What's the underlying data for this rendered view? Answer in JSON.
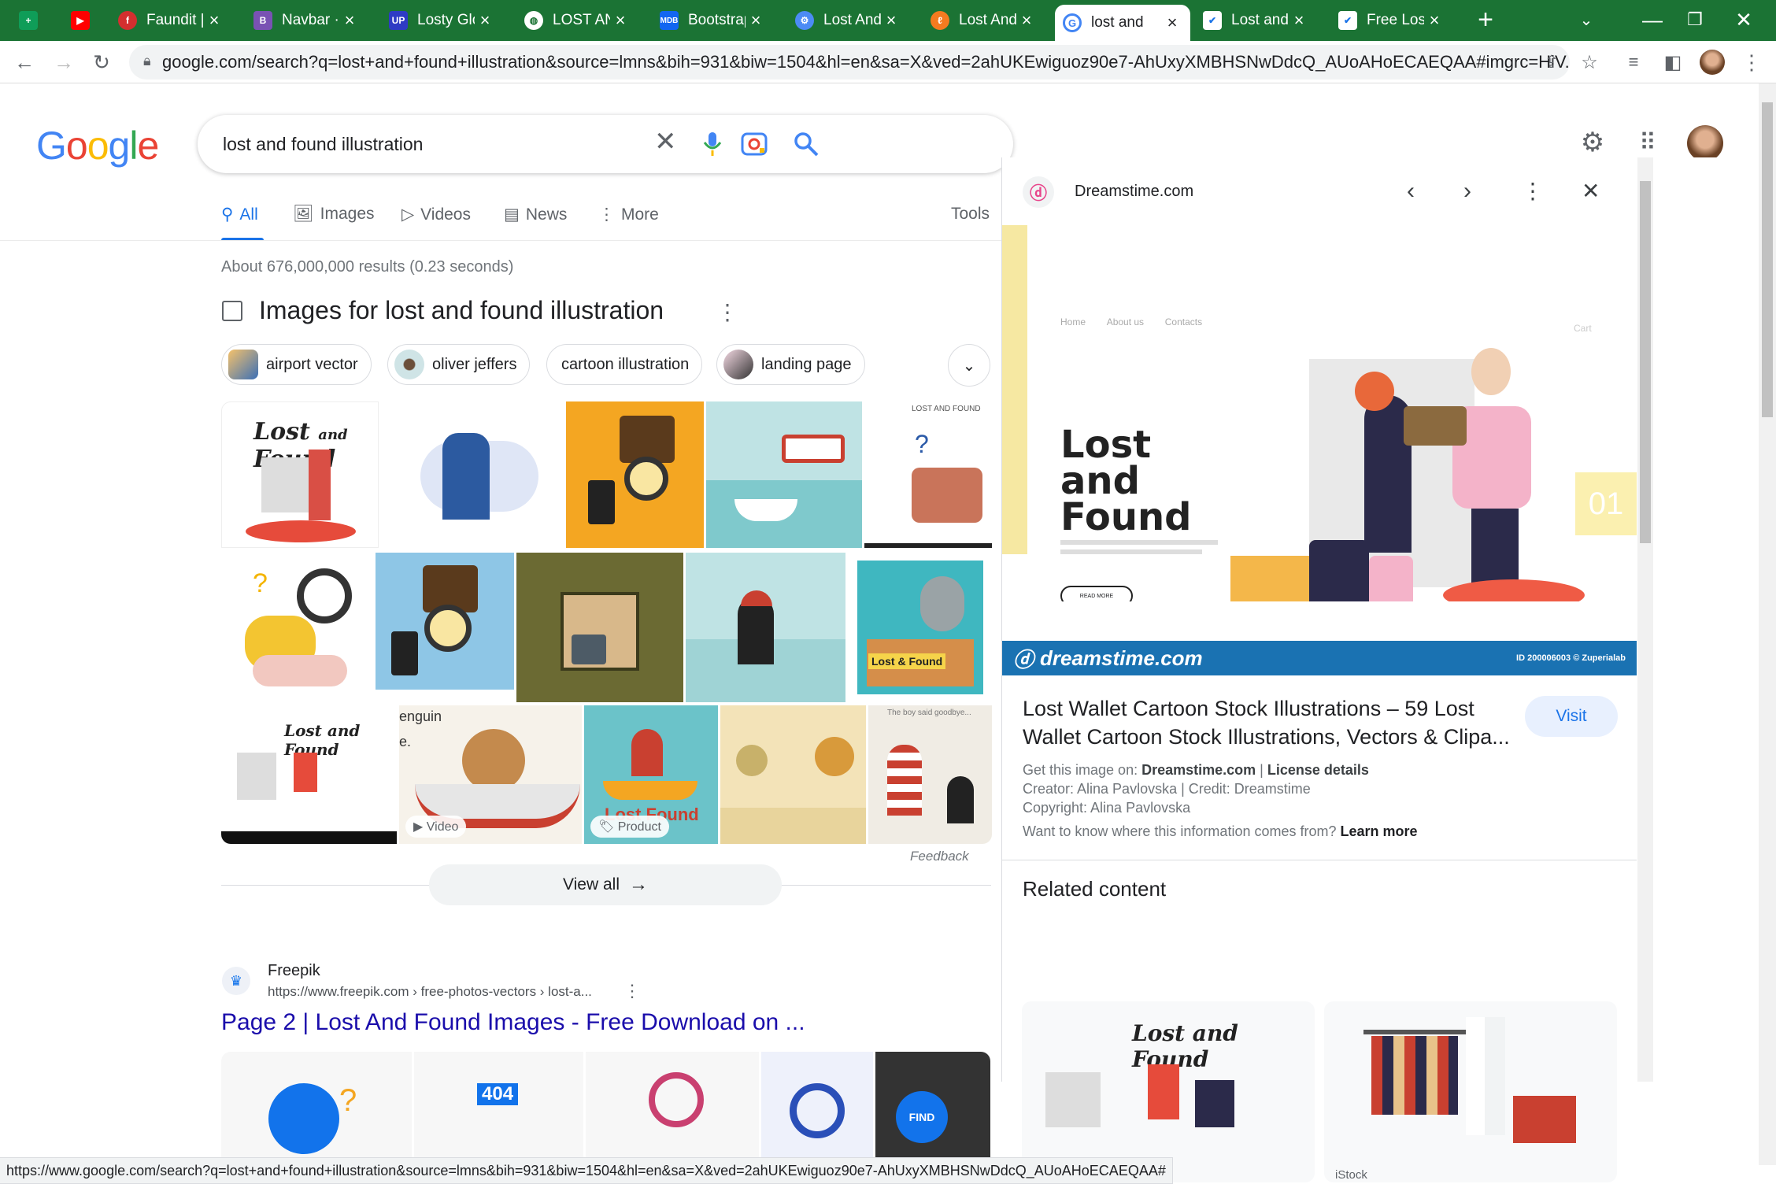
{
  "tabs": [
    {
      "label": "",
      "icon": "sheets-icon",
      "color": "#0f9d58"
    },
    {
      "label": "",
      "icon": "youtube-icon",
      "color": "#ff0000"
    },
    {
      "label": "Faundit |",
      "icon": "faundit-icon",
      "color": "#d32f2f"
    },
    {
      "label": "Navbar ·",
      "icon": "bootstrap-icon",
      "color": "#7952b3"
    },
    {
      "label": "Losty Glo",
      "icon": "up-icon",
      "color": "#2e3bc4"
    },
    {
      "label": "LOST ANI",
      "icon": "globe-icon",
      "color": "#ffffff"
    },
    {
      "label": "Bootstrap",
      "icon": "mdb-icon",
      "color": "#1266f1"
    },
    {
      "label": "Lost And",
      "icon": "gear-icon",
      "color": "#4c8bf5"
    },
    {
      "label": "Lost And",
      "icon": "lost-icon",
      "color": "#f47b20"
    },
    {
      "label": "lost and",
      "icon": "google-icon",
      "color": "#4285f4"
    },
    {
      "label": "Lost and",
      "icon": "check-icon",
      "color": "#1a73e8"
    },
    {
      "label": "Free Lost",
      "icon": "check-icon",
      "color": "#1a73e8"
    }
  ],
  "browser": {
    "url": "google.com/search?q=lost+and+found+illustration&source=lmns&bih=931&biw=1504&hl=en&sa=X&ved=2ahUKEwiguoz90e7-AhUxyXMBHSNwDdcQ_AUoAHoECAEQAA#imgrc=HiV..."
  },
  "search": {
    "query": "lost and found illustration",
    "logo": "Google"
  },
  "nav": {
    "all": "All",
    "images": "Images",
    "videos": "Videos",
    "news": "News",
    "more": "More",
    "tools": "Tools"
  },
  "results": {
    "count": "About 676,000,000 results (0.23 seconds)"
  },
  "images_section": {
    "title": "Images for lost and found illustration",
    "chips": [
      "airport vector",
      "oliver jeffers",
      "cartoon illustration",
      "landing page"
    ],
    "video_badge": "Video",
    "product_badge": "Product",
    "feedback": "Feedback",
    "view_all": "View all"
  },
  "result1": {
    "site": "Freepik",
    "url": "https://www.freepik.com › free-photos-vectors › lost-a...",
    "title": "Page 2 | Lost And Found Images - Free Download on ..."
  },
  "panel": {
    "source": "Dreamstime.com",
    "image_heading": "Lost and Found",
    "image_nav": [
      "Home",
      "About us",
      "Contacts"
    ],
    "cart": "Cart",
    "read_more": "READ MORE",
    "slide_number": "01",
    "watermark": "dreamstime.com",
    "watermark_id": "ID 200006003 © Zuperialab",
    "title": "Lost Wallet Cartoon Stock Illustrations – 59 Lost Wallet Cartoon Stock Illustrations, Vectors & Clipa...",
    "visit": "Visit",
    "get_image_prefix": "Get this image on:",
    "get_image_site": "Dreamstime.com",
    "license": "License details",
    "creator": "Creator: Alina Pavlovska | Credit: Dreamstime",
    "copyright": "Copyright: Alina Pavlovska",
    "want_to_know": "Want to know where this information comes from?",
    "learn_more": "Learn more",
    "related": "Related content",
    "istock": "iStock"
  },
  "status_url": "https://www.google.com/search?q=lost+and+found+illustration&source=lmns&bih=931&biw=1504&hl=en&sa=X&ved=2ahUKEwiguoz90e7-AhUxyXMBHSNwDdcQ_AUoAHoECAEQAA#"
}
